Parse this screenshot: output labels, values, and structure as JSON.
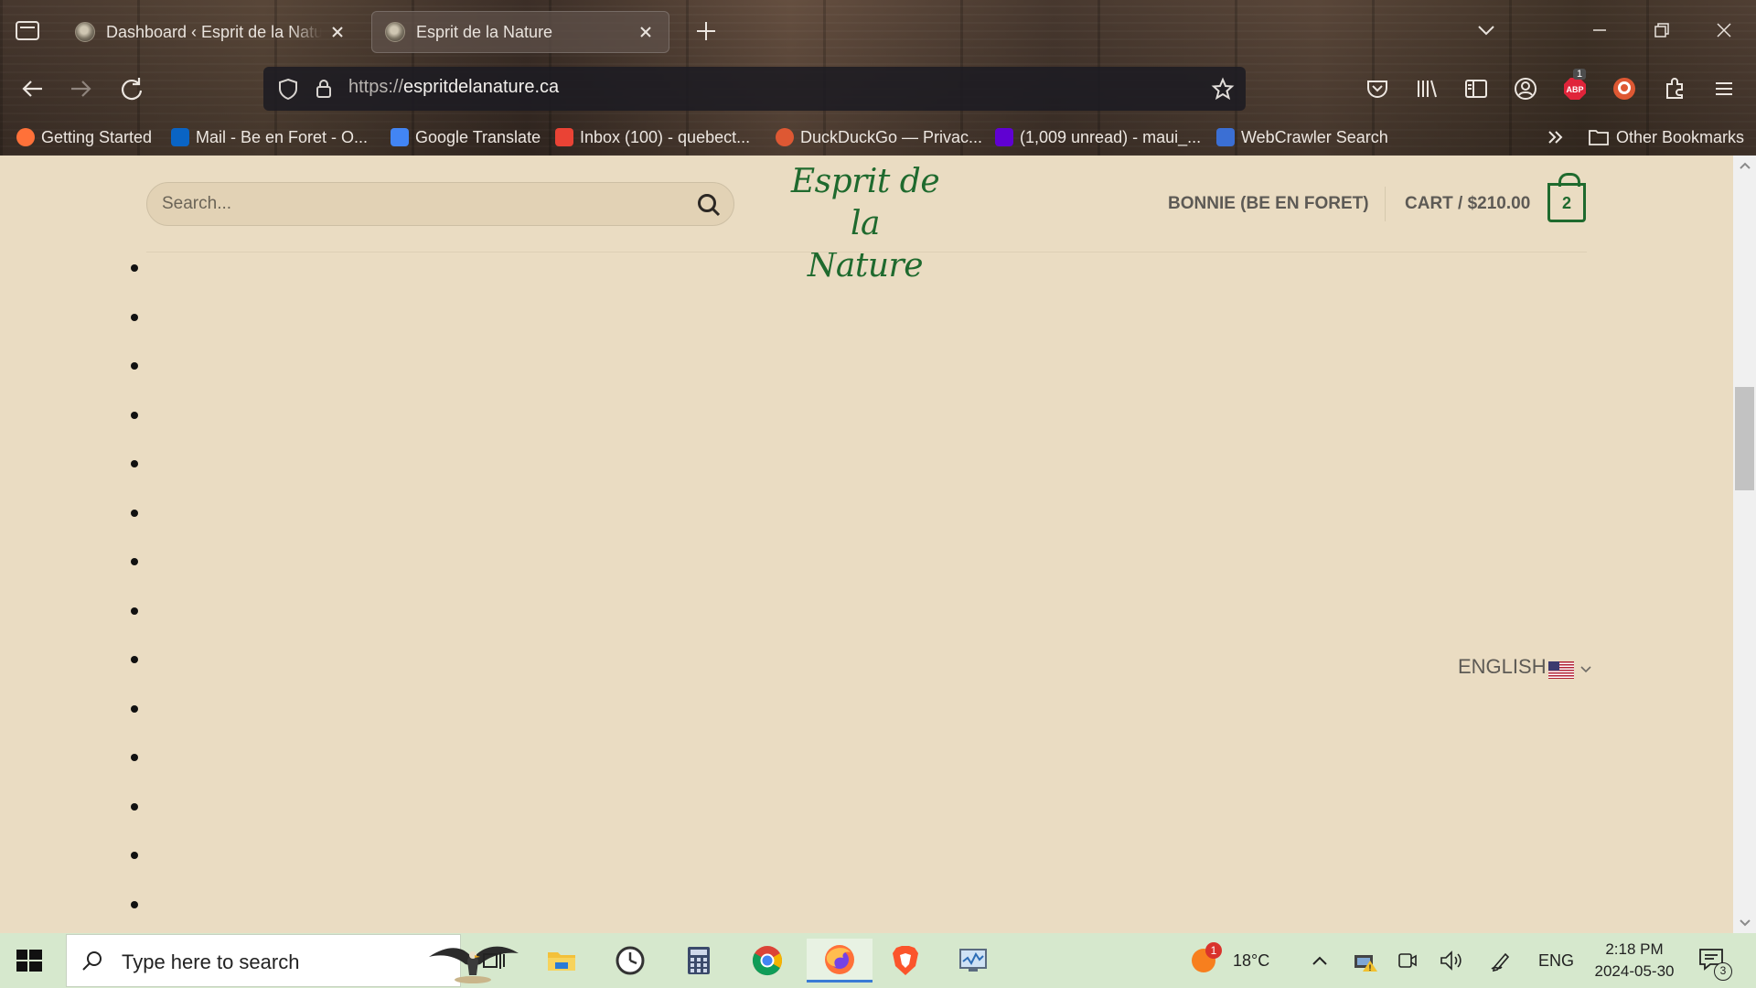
{
  "browser": {
    "tabs": [
      {
        "title": "Dashboard ‹ Esprit de la Nature",
        "active": false
      },
      {
        "title": "Esprit de la Nature",
        "active": true
      }
    ],
    "url": {
      "scheme": "https://",
      "host": "espritdelanature.ca"
    },
    "bookmarks": [
      {
        "label": "Getting Started",
        "icon": "firefox-icon",
        "color": "#ff7139"
      },
      {
        "label": "Mail - Be en Foret - O...",
        "icon": "outlook-icon",
        "color": "#0a64c4"
      },
      {
        "label": "Google Translate",
        "icon": "google-translate-icon",
        "color": "#4285f4"
      },
      {
        "label": "Inbox (100) - quebect...",
        "icon": "gmail-icon",
        "color": "#ea4335"
      },
      {
        "label": "DuckDuckGo — Privac...",
        "icon": "duckduckgo-icon",
        "color": "#de5833"
      },
      {
        "label": "(1,009 unread) - maui_...",
        "icon": "yahoo-mail-icon",
        "color": "#6001d2"
      },
      {
        "label": "WebCrawler Search",
        "icon": "webcrawler-icon",
        "color": "#3b6fd4"
      }
    ],
    "other_bookmarks": "Other Bookmarks",
    "adblock_badge": "1"
  },
  "site": {
    "search_placeholder": "Search...",
    "logo_line1": "Esprit de",
    "logo_line2": "la Nature",
    "account": "BONNIE (BE EN FORET)",
    "cart_label": "CART / $210.00",
    "cart_count": "2",
    "language": "ENGLISH",
    "bullet_count": 14,
    "brand_color": "#1f6a2e"
  },
  "taskbar": {
    "search_placeholder": "Type here to search",
    "weather_temp": "18°C",
    "weather_badge": "1",
    "language": "ENG",
    "time": "2:18 PM",
    "date": "2024-05-30",
    "notification_count": "3",
    "apps": [
      "task-view",
      "file-explorer",
      "clock-app",
      "calculator",
      "chrome",
      "firefox",
      "brave",
      "monitor-app"
    ]
  }
}
